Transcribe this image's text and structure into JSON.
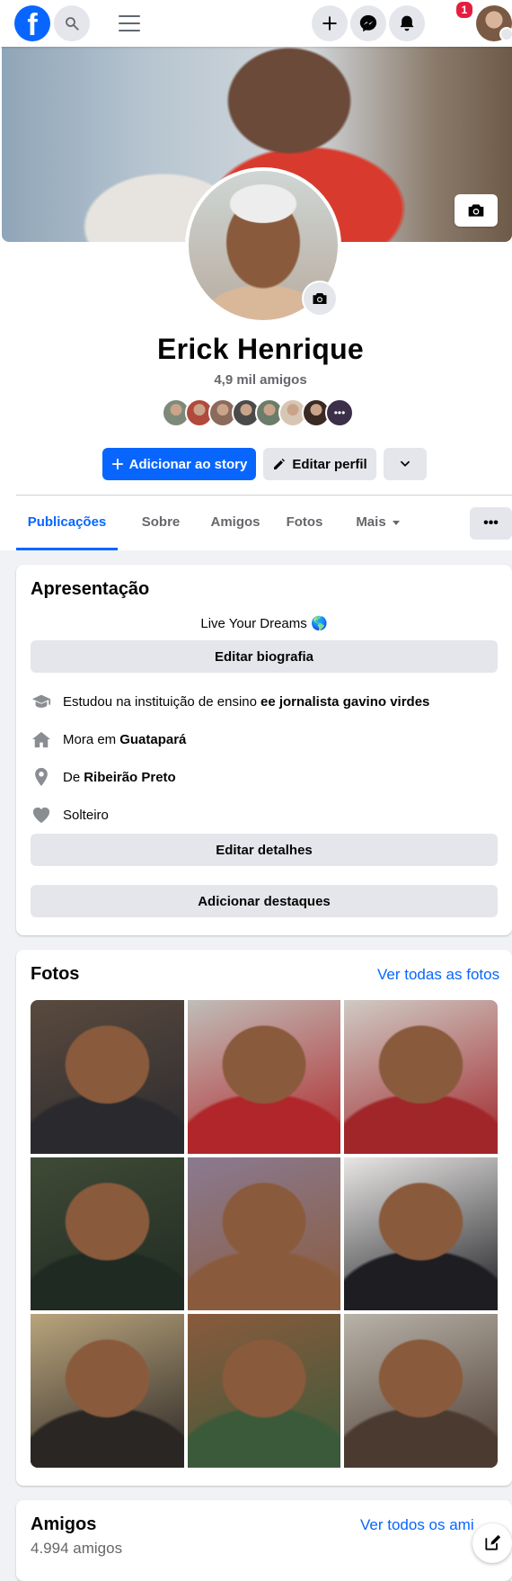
{
  "topbar": {
    "logo_letter": "f",
    "notification_count": "1"
  },
  "profile": {
    "name": "Erick Henrique",
    "friends_count": "4,9 mil amigos",
    "friend_avatar_colors": [
      "#7d8a7a",
      "#b24a3c",
      "#8b6b5c",
      "#4a4a4a",
      "#6c7c6a",
      "#d8c6b4",
      "#3a2a24",
      "#3b2f4a"
    ],
    "more_glyph": "•••"
  },
  "actions": {
    "add_story_label": "Adicionar ao story",
    "edit_profile_label": "Editar perfil"
  },
  "tabs": [
    {
      "label": "Publicações",
      "active": true
    },
    {
      "label": "Sobre"
    },
    {
      "label": "Amigos"
    },
    {
      "label": "Fotos"
    },
    {
      "label": "Mais"
    }
  ],
  "tabs_more_glyph": "•••",
  "intro": {
    "title": "Apresentação",
    "bio": "Live Your Dreams 🌎",
    "edit_bio_label": "Editar biografia",
    "items": [
      {
        "icon": "graduation-cap-icon",
        "text": "Estudou na instituição de ensino",
        "bold": "ee jornalista gavino virdes"
      },
      {
        "icon": "home-icon",
        "text": "Mora em",
        "bold": "Guatapará"
      },
      {
        "icon": "location-pin-icon",
        "text": "De",
        "bold": "Ribeirão Preto"
      },
      {
        "icon": "heart-icon",
        "text": "Solteiro",
        "bold": ""
      }
    ],
    "edit_details_label": "Editar detalhes",
    "add_highlights_label": "Adicionar destaques"
  },
  "photos": {
    "title": "Fotos",
    "see_all_label": "Ver todas as fotos",
    "tile_colors": [
      [
        "#5a4a3e",
        "#2a2a2e"
      ],
      [
        "#c0bdb8",
        "#b0262a"
      ],
      [
        "#cfcac4",
        "#a0262a"
      ],
      [
        "#3f4a36",
        "#1f2a22"
      ],
      [
        "#8a7a90",
        "#8a5a3c"
      ],
      [
        "#e8e6e4",
        "#1e1e22"
      ],
      [
        "#b9a47c",
        "#2a2624"
      ],
      [
        "#8a5a3c",
        "#3b5a3a"
      ],
      [
        "#b8b2a8",
        "#4a3a30"
      ]
    ]
  },
  "friends": {
    "title": "Amigos",
    "count": "4.994 amigos",
    "see_all_label": "Ver todos os ami"
  },
  "colors": {
    "brand_blue": "#0866ff",
    "badge_red": "#e41e3f",
    "page_bg": "#f0f2f5"
  }
}
